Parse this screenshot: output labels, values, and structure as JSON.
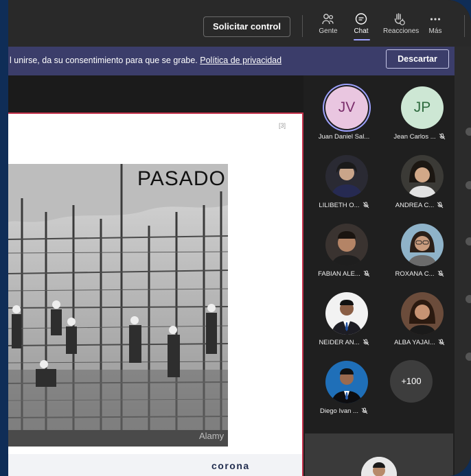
{
  "toolbar": {
    "request_control": "Solicitar control",
    "people": "Gente",
    "chat": "Chat",
    "reactions": "Reacciones",
    "more": "Más"
  },
  "banner": {
    "text": "l unirse, da su consentimiento para que se grabe.",
    "link": "Política de privacidad",
    "dismiss": "Descartar"
  },
  "slide": {
    "number": "[3]",
    "title": "PASADO",
    "watermark": "Alamy",
    "brand": "corona"
  },
  "participants": [
    {
      "name": "Juan Daniel Sal...",
      "initials": "JV",
      "muted": false,
      "bg": "#e9c6e0",
      "fg": "#7a2e6b"
    },
    {
      "name": "Jean Carlos ...",
      "initials": "JP",
      "muted": true,
      "bg": "#cde7d4",
      "fg": "#2f6b3f"
    },
    {
      "name": "LILIBETH O...",
      "muted": true
    },
    {
      "name": "ANDREA C...",
      "muted": true
    },
    {
      "name": "FABIAN ALE...",
      "muted": true
    },
    {
      "name": "ROXANA C...",
      "muted": true
    },
    {
      "name": "NEIDER AN...",
      "muted": true
    },
    {
      "name": "ALBA YAJAI...",
      "muted": true
    },
    {
      "name": "Diego Ivan ...",
      "muted": true
    }
  ],
  "overflow_count": "+100",
  "colors": {
    "accent": "#9ea2ff",
    "banner": "#3b3d6a",
    "share_border": "#c4314b"
  }
}
